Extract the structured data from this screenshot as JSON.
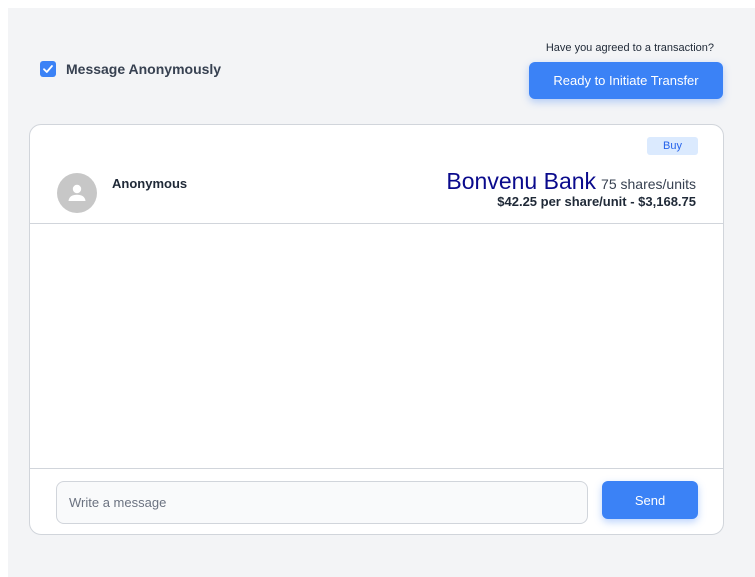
{
  "header": {
    "anonymous_checkbox": {
      "label": "Message Anonymously",
      "checked": true
    },
    "agree_prompt": "Have you agreed to a transaction?",
    "transfer_button_label": "Ready to Initiate Transfer"
  },
  "trade_card": {
    "badge": "Buy",
    "sender": {
      "name": "Anonymous",
      "avatar_icon": "user-silhouette-icon"
    },
    "stock_name": "Bonvenu Bank",
    "shares_label": "75 shares/units",
    "price_line": "$42.25 per share/unit - $3,168.75"
  },
  "composer": {
    "placeholder": "Write a message",
    "value": "",
    "send_label": "Send"
  },
  "colors": {
    "accent": "#3b82f6",
    "stock_name": "#0a0a8c",
    "badge_bg": "#dbeafe",
    "page_bg": "#f3f4f6"
  }
}
